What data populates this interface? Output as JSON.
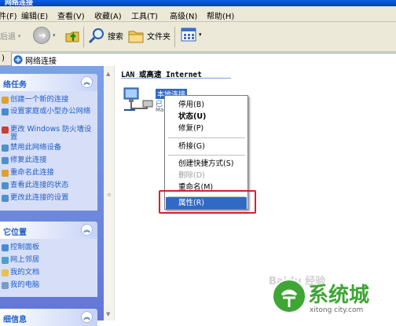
{
  "window": {
    "title": "网络连接"
  },
  "menu": [
    {
      "label": "件(F)"
    },
    {
      "label": "编辑(E)"
    },
    {
      "label": "查看(V)"
    },
    {
      "label": "收藏(A)"
    },
    {
      "label": "工具(T)"
    },
    {
      "label": "高级(N)"
    },
    {
      "label": "帮助(H)"
    }
  ],
  "toolbar": {
    "back_label": "后退",
    "search_label": "搜索",
    "folders_label": "文件夹"
  },
  "address": {
    "value": "网络连接"
  },
  "left": {
    "tasks_title": "络任务",
    "tasks": [
      {
        "label": "创建一个新的连接"
      },
      {
        "label": "设置家庭或小型办公网络"
      },
      {
        "label": "更改 Windows 防火墙设置"
      },
      {
        "label": "禁用此网络设备"
      },
      {
        "label": "修复此连接"
      },
      {
        "label": "重命名此连接"
      },
      {
        "label": "查看此连接的状态"
      },
      {
        "label": "更改此连接的设置"
      }
    ],
    "places_title": "它位置",
    "places": [
      {
        "label": "控制面板"
      },
      {
        "label": "网上邻居"
      },
      {
        "label": "我的文档"
      },
      {
        "label": "我的电脑"
      }
    ],
    "details_title": "细信息"
  },
  "main": {
    "group_title": "LAN 或高速 Internet",
    "connection": {
      "name": "本地连接",
      "status": "已",
      "device": "Mac"
    }
  },
  "context_menu": [
    {
      "label": "停用(B)",
      "state": "normal"
    },
    {
      "label": "状态(U)",
      "state": "bold"
    },
    {
      "label": "修复(P)",
      "state": "normal"
    },
    {
      "label": "桥接(G)",
      "state": "normal"
    },
    {
      "label": "创建快捷方式(S)",
      "state": "normal"
    },
    {
      "label": "删除(D)",
      "state": "disabled"
    },
    {
      "label": "重命名(M)",
      "state": "normal"
    },
    {
      "label": "属性(R)",
      "state": "selected"
    }
  ],
  "watermark": {
    "brand": "系统城",
    "url": "xitong city.com",
    "faint": "Baidu 经验"
  },
  "colors": {
    "highlight": "#316ac5",
    "annotation": "#d8202a",
    "task_link": "#215dc6"
  }
}
